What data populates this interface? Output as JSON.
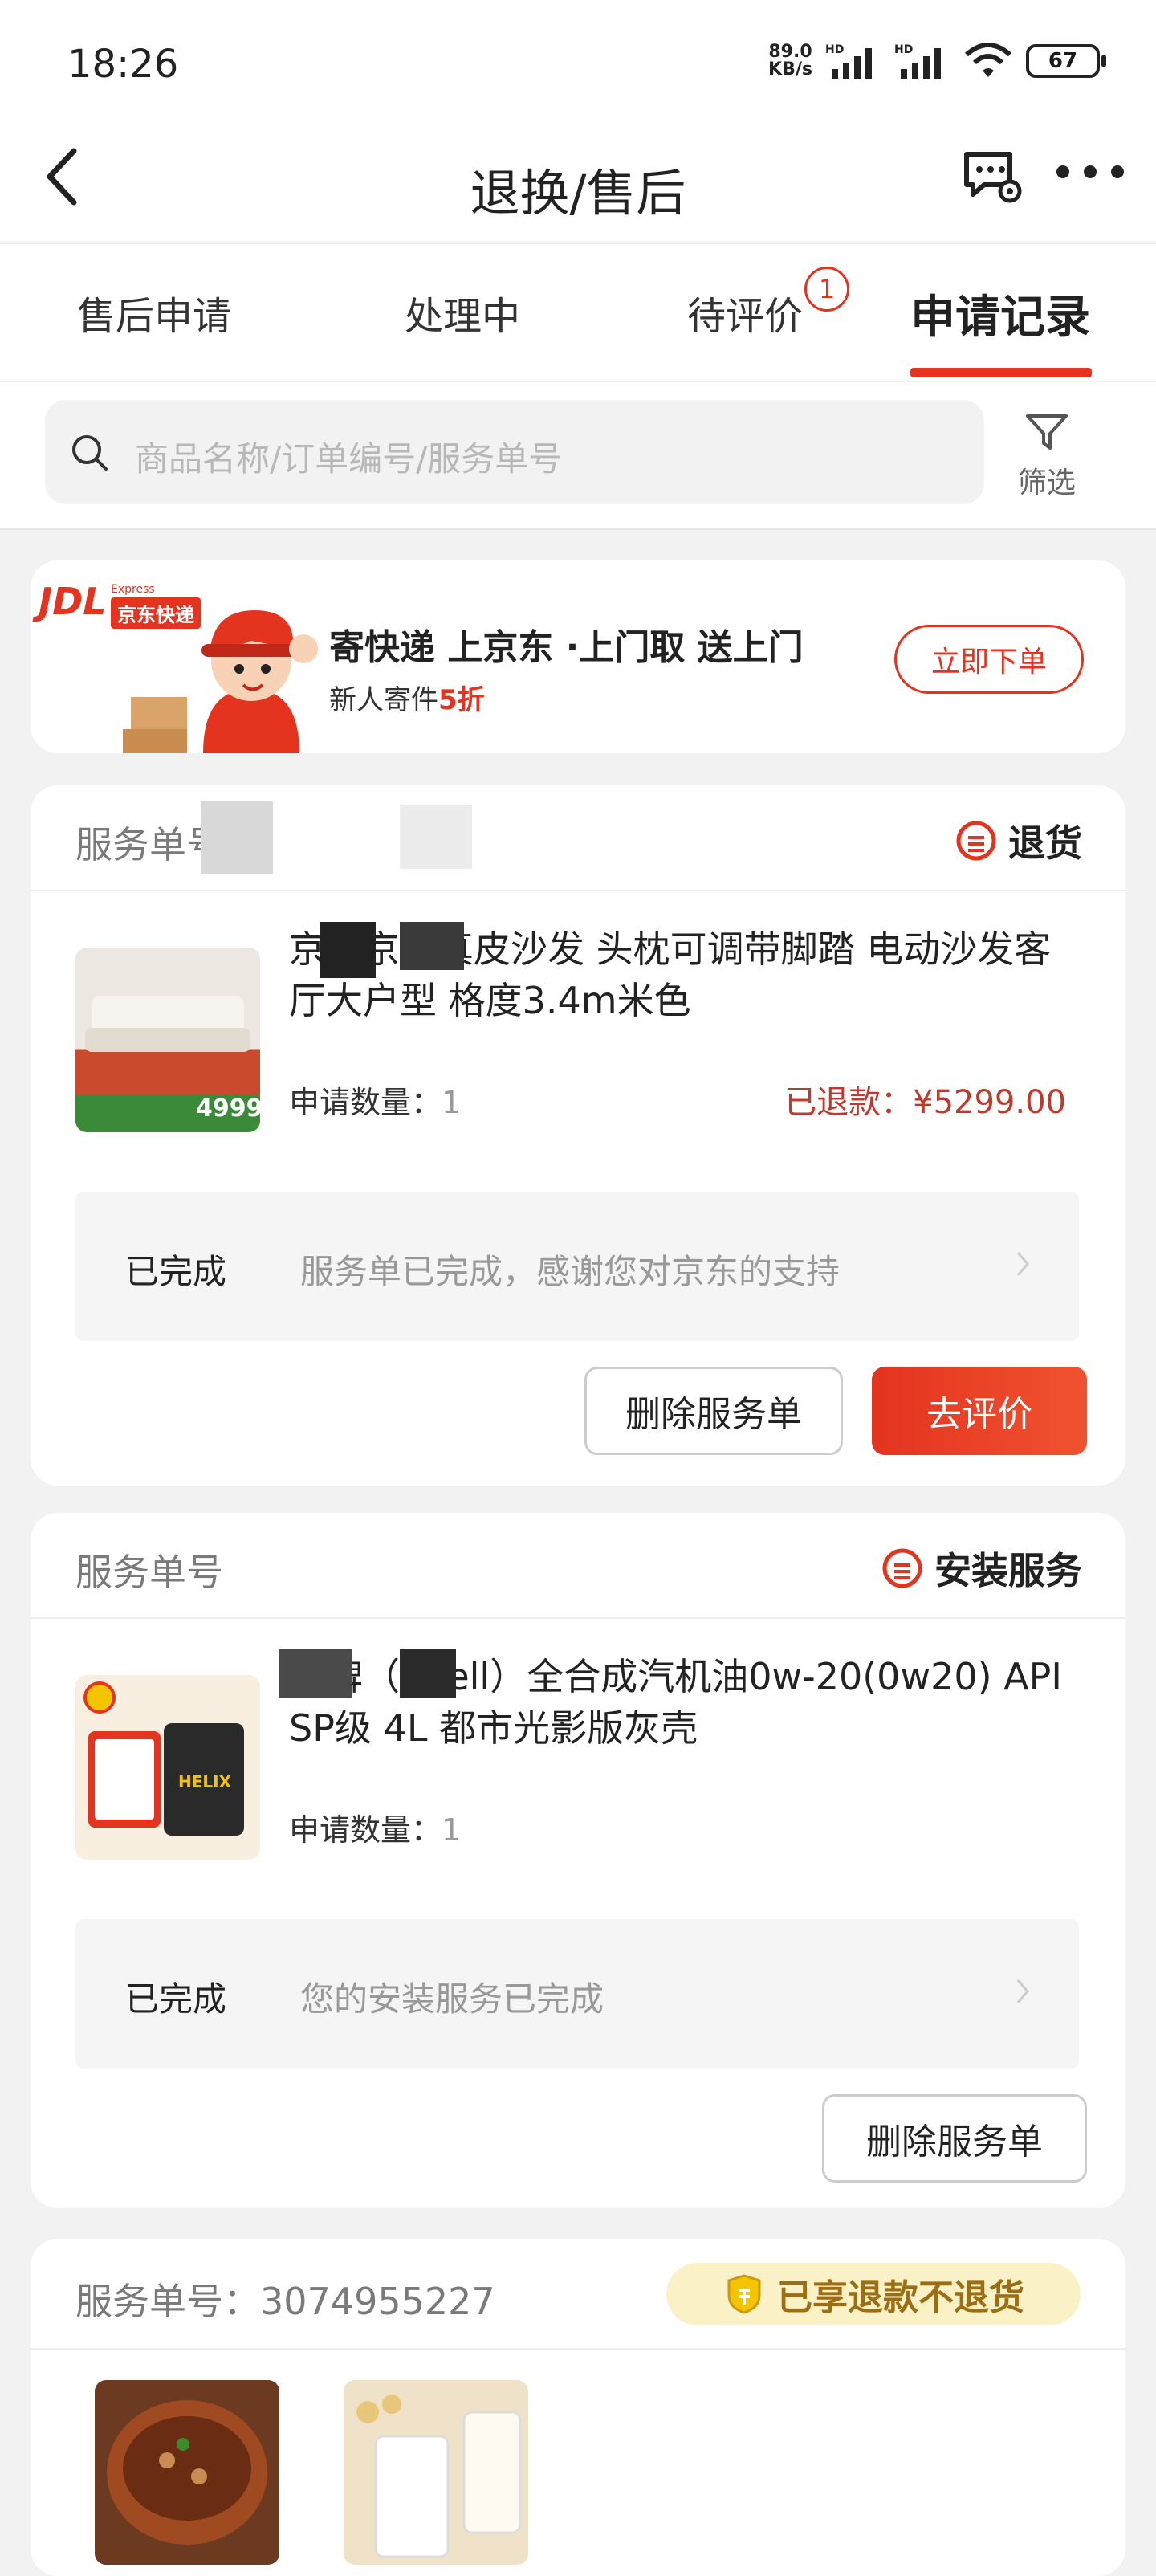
{
  "status_bar": {
    "time": "18:26",
    "net_speed_value": "89.0",
    "net_speed_unit": "KB/s",
    "battery": "67"
  },
  "nav": {
    "title": "退换/售后"
  },
  "tabs": [
    {
      "label": "售后申请"
    },
    {
      "label": "处理中"
    },
    {
      "label": "待评价",
      "badge": "1"
    },
    {
      "label": "申请记录",
      "active": true
    }
  ],
  "search": {
    "placeholder": "商品名称/订单编号/服务单号",
    "filter_label": "筛选"
  },
  "banner": {
    "logo": "JDL",
    "logo_express": "Express",
    "logo_cn": "京东快递",
    "title": "寄快递 上京东 ·上门取 送上门",
    "subtitle_prefix": "新人寄件",
    "subtitle_highlight": "5折",
    "button": "立即下单"
  },
  "service_orders": [
    {
      "number_label": "服务单号",
      "type": "退货",
      "product_name": "京东京造真皮沙发 头枕可调带脚踏 电动沙发客厅大户型 格度3.4m米色",
      "thumb_text": "4999",
      "qty_label": "申请数量：",
      "qty_value": "1",
      "refund": "已退款：¥5299.00",
      "status": "已完成",
      "status_msg": "服务单已完成，感谢您对京东的支持",
      "buttons": {
        "delete": "删除服务单",
        "review": "去评价"
      }
    },
    {
      "number_label": "服务单号",
      "type": "安装服务",
      "product_name": "壳牌（Shell）全合成汽机油0w-20(0w20) API SP级 4L 都市光影版灰壳",
      "thumb_text": "HELIX",
      "qty_label": "申请数量：",
      "qty_value": "1",
      "status": "已完成",
      "status_msg": "您的安装服务已完成",
      "buttons": {
        "delete": "删除服务单"
      }
    },
    {
      "number_label": "服务单号：3074955227",
      "tag": "已享退款不退货"
    }
  ],
  "colors": {
    "accent": "#e4331f",
    "page_bg": "#f2f2f2",
    "pill_bg": "#fbf1c6"
  }
}
